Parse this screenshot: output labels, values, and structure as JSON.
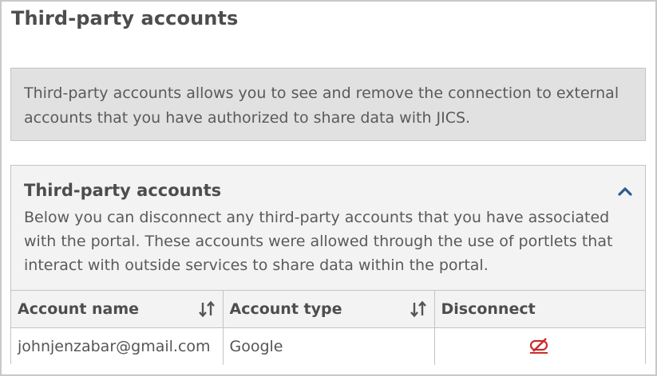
{
  "page": {
    "title": "Third-party accounts"
  },
  "info": {
    "text": "Third-party accounts allows you to see and remove the connection to external accounts that you have authorized to share data with JICS."
  },
  "panel": {
    "title": "Third-party accounts",
    "collapse_icon": "chevron-up-icon",
    "description": "Below you can disconnect any third-party accounts that you have associated with the portal. These accounts were allowed through the use of portlets that interact with outside services to share data within the portal.",
    "accent_color": "#2a5d8f"
  },
  "table": {
    "headers": {
      "account_name": "Account name",
      "account_type": "Account type",
      "disconnect": "Disconnect"
    },
    "sort_icon": "sort-arrows-icon",
    "rows": [
      {
        "account_name": "johnjenzabar@gmail.com",
        "account_type": "Google",
        "disconnect_icon": "unlink-icon",
        "disconnect_color": "#cc2b2b"
      }
    ]
  }
}
